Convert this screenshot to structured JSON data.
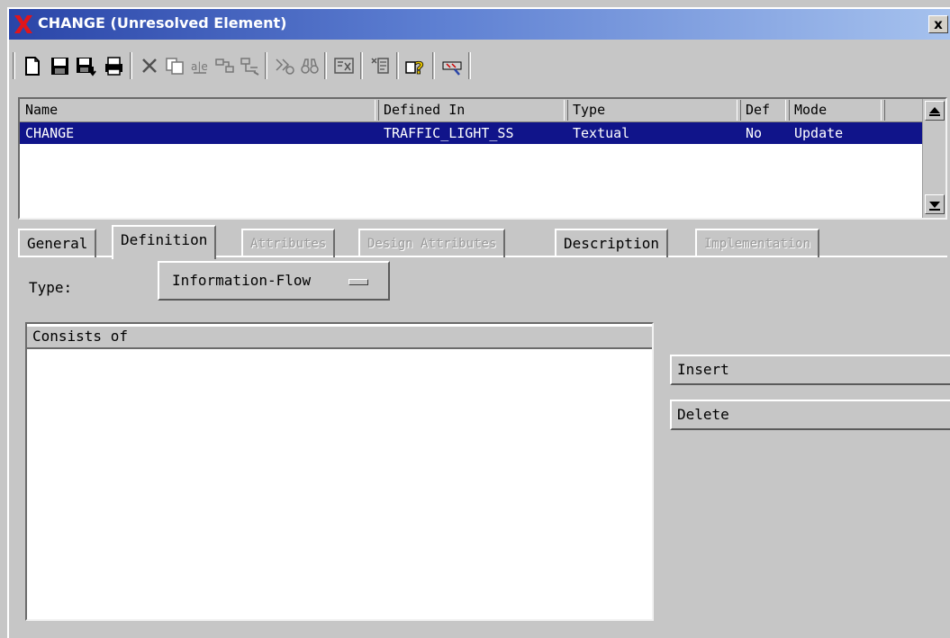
{
  "window": {
    "title": "CHANGE (Unresolved Element)",
    "close_label": "x"
  },
  "toolbar": {
    "buttons": [
      {
        "name": "new-icon"
      },
      {
        "name": "save-icon"
      },
      {
        "name": "save-down-icon"
      },
      {
        "name": "print-icon"
      },
      {
        "name": "delete-icon"
      },
      {
        "name": "copy-icon"
      },
      {
        "name": "rename-icon"
      },
      {
        "name": "connect-icon"
      },
      {
        "name": "structure-icon"
      },
      {
        "name": "find-icon"
      },
      {
        "name": "binoculars-icon"
      },
      {
        "name": "view-icon"
      },
      {
        "name": "report-icon"
      },
      {
        "name": "help-icon"
      },
      {
        "name": "tool-icon"
      }
    ]
  },
  "list": {
    "columns": [
      "Name",
      "Defined In",
      "Type",
      "Def",
      "Mode"
    ],
    "rows": [
      {
        "name": "CHANGE",
        "defined_in": "TRAFFIC_LIGHT_SS",
        "type": "Textual",
        "def": "No",
        "mode": "Update"
      }
    ]
  },
  "tabs": [
    {
      "label": "General",
      "state": "normal"
    },
    {
      "label": "Definition",
      "state": "active"
    },
    {
      "label": "Attributes",
      "state": "disabled"
    },
    {
      "label": "Design Attributes",
      "state": "disabled"
    },
    {
      "label": "Description",
      "state": "normal"
    },
    {
      "label": "Implementation",
      "state": "disabled"
    }
  ],
  "definition": {
    "type_label": "Type:",
    "type_value": "Information-Flow",
    "consists_header": "Consists of",
    "insert_label": "Insert",
    "delete_label": "Delete"
  },
  "colors": {
    "selection": "#10148a",
    "title_left": "#2a45a8",
    "title_right": "#a6c2ee",
    "logo_red": "#e0151b"
  }
}
